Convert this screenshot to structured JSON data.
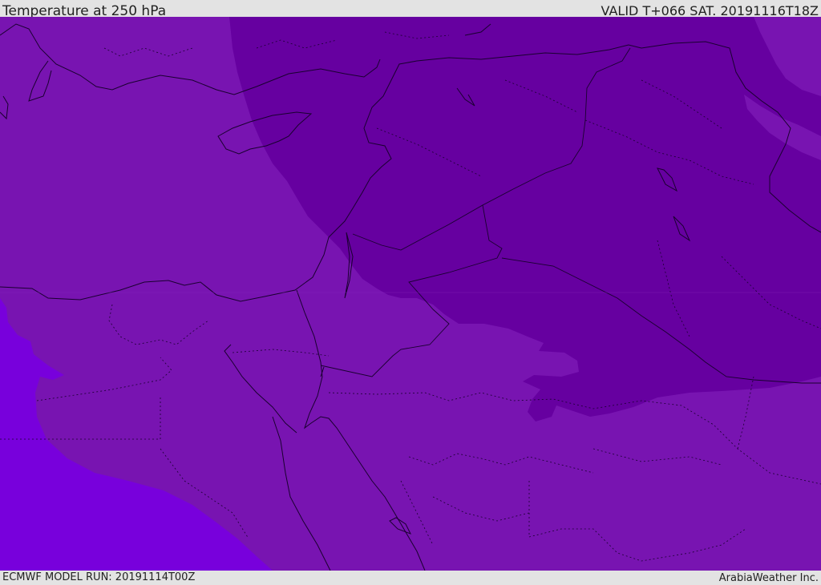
{
  "header": {
    "title": "Temperature at 250 hPa",
    "valid_time": "VALID T+066 SAT. 20191116T18Z"
  },
  "footer": {
    "model_run": "ECMWF MODEL RUN: 20191114T00Z",
    "credit": "ArabiaWeather Inc."
  },
  "map": {
    "colors": {
      "base_region": "#7814b1",
      "cold_region": "#6600a0",
      "warm_region": "#7800dc",
      "coastline": "#1a0030",
      "border": "#1a0030"
    }
  }
}
